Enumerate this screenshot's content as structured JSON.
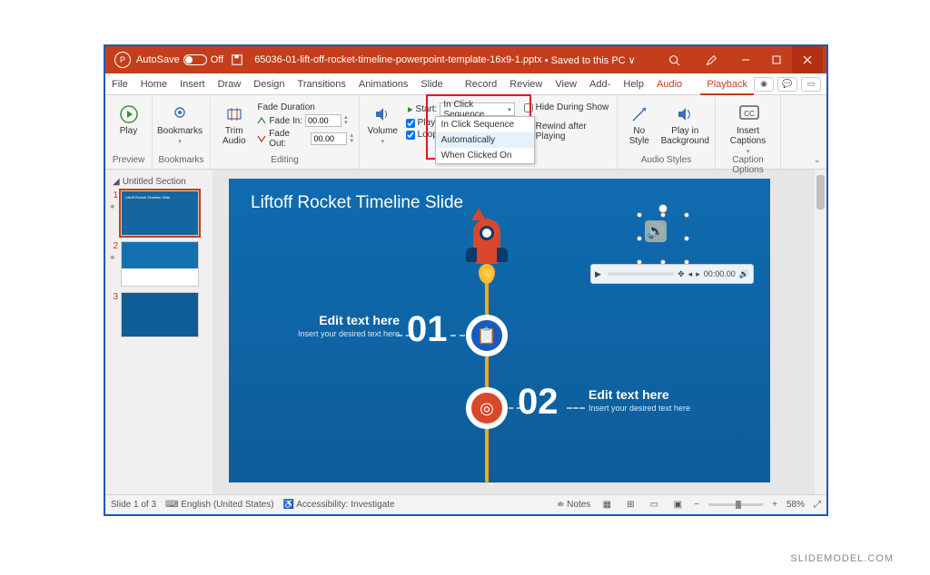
{
  "titlebar": {
    "autosave_label": "AutoSave",
    "autosave_state": "Off",
    "filename": "65036-01-lift-off-rocket-timeline-powerpoint-template-16x9-1.pptx",
    "save_status": "Saved to this PC"
  },
  "tabs": [
    "File",
    "Home",
    "Insert",
    "Draw",
    "Design",
    "Transitions",
    "Animations",
    "Slide Show",
    "Record",
    "Review",
    "View",
    "Add-ins",
    "Help",
    "Audio Format",
    "Playback"
  ],
  "active_tab": "Playback",
  "context_tabs": [
    "Audio Format",
    "Playback"
  ],
  "ribbon": {
    "preview": {
      "play": "Play",
      "group_label": "Preview"
    },
    "bookmarks": {
      "label": "Bookmarks",
      "group_label": "Bookmarks"
    },
    "editing": {
      "trim": "Trim Audio",
      "fade_caption": "Fade Duration",
      "fade_in_label": "Fade In:",
      "fade_in_value": "00.00",
      "fade_out_label": "Fade Out:",
      "fade_out_value": "00.00",
      "group_label": "Editing"
    },
    "audio_options": {
      "volume": "Volume",
      "start_label": "Start:",
      "start_value": "In Click Sequence",
      "start_options": [
        "In Click Sequence",
        "Automatically",
        "When Clicked On"
      ],
      "play_across": "Play Across Slides",
      "loop": "Loop until Stopped",
      "hide": "Hide During Show",
      "rewind": "Rewind after Playing",
      "group_label": "Audio Options"
    },
    "audio_styles": {
      "no_style": "No Style",
      "play_bg": "Play in Background",
      "group_label": "Audio Styles"
    },
    "captions": {
      "insert": "Insert Captions",
      "group_label": "Caption Options"
    }
  },
  "thumbnails": {
    "section": "Untitled Section",
    "slides": [
      {
        "num": "1",
        "has_anim": true,
        "active": true
      },
      {
        "num": "2",
        "has_anim": true,
        "active": false
      },
      {
        "num": "3",
        "has_anim": false,
        "active": false
      }
    ]
  },
  "slide": {
    "title": "Liftoff Rocket Timeline Slide",
    "item1": {
      "num": "01",
      "heading": "Edit text here",
      "sub": "Insert your desired text here"
    },
    "item2": {
      "num": "02",
      "heading": "Edit text here",
      "sub": "Insert your desired text here"
    },
    "player_time": "00:00.00"
  },
  "statusbar": {
    "slide_pos": "Slide 1 of 3",
    "language": "English (United States)",
    "accessibility": "Accessibility: Investigate",
    "notes": "Notes",
    "zoom": "58%"
  },
  "watermark": "SLIDEMODEL.COM"
}
